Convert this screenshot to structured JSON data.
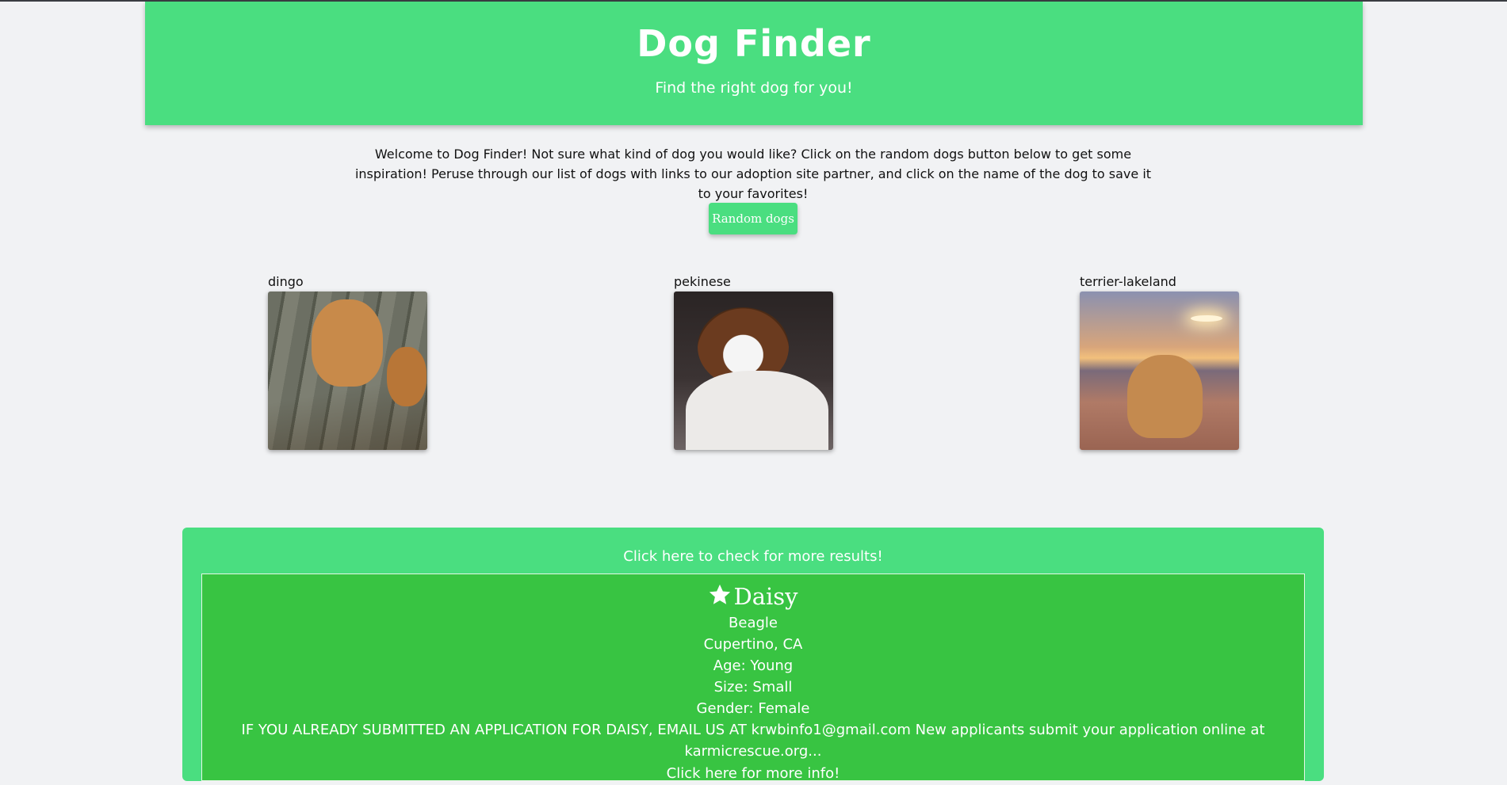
{
  "header": {
    "title": "Dog Finder",
    "subtitle": "Find the right dog for you!"
  },
  "intro": {
    "text": "Welcome to Dog Finder! Not sure what kind of dog you would like? Click on the random dogs button below to get some inspiration! Peruse through our list of dogs with links to our adoption site partner, and click on the name of the dog to save it to your favorites!"
  },
  "random_button": {
    "label": "Random dogs"
  },
  "random_dogs": [
    {
      "breed": "dingo"
    },
    {
      "breed": "pekinese"
    },
    {
      "breed": "terrier-lakeland"
    }
  ],
  "results": {
    "more_link": "Click here to check for more results!",
    "pet": {
      "name": "Daisy",
      "breed": "Beagle",
      "location": "Cupertino, CA",
      "age": "Age: Young",
      "size": "Size: Small",
      "gender": "Gender: Female",
      "description": "IF YOU ALREADY SUBMITTED AN APPLICATION FOR DAISY, EMAIL US AT krwbinfo1@gmail.com New applicants submit your application online at karmicrescue.org...",
      "info_link": "Click here for more info!",
      "favorite_icon": "star-icon"
    }
  },
  "colors": {
    "header_green": "#4ade80",
    "card_green": "#38c442",
    "background": "#f1f2f4"
  }
}
